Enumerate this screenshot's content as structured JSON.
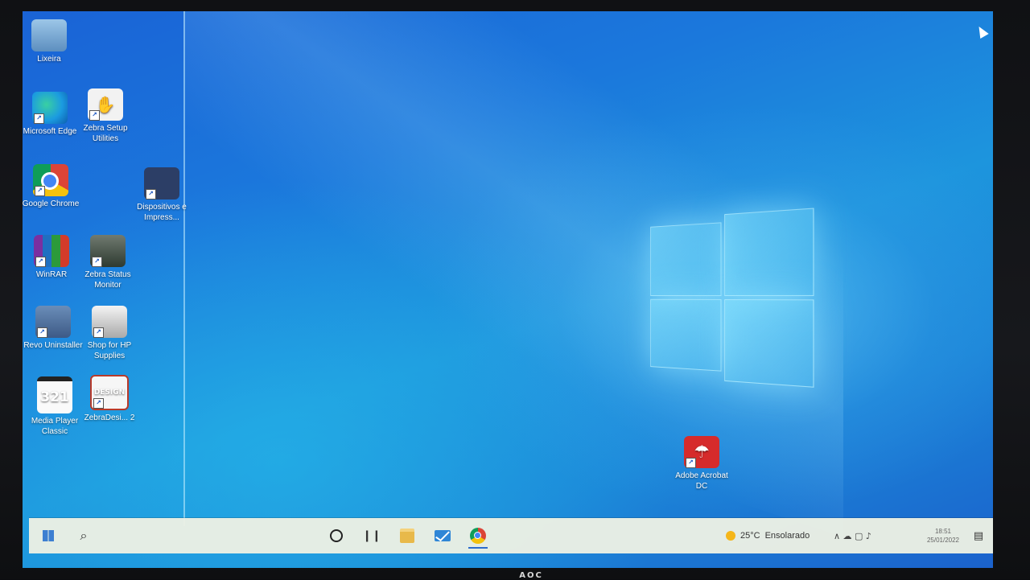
{
  "desktop": {
    "icons": [
      {
        "id": "recycle-bin",
        "label": "Lixeira",
        "icon": "recycle-bin-icon",
        "shortcut": false
      },
      {
        "id": "microsoft-edge",
        "label": "Microsoft Edge",
        "icon": "edge-icon",
        "shortcut": true
      },
      {
        "id": "zebra-setup",
        "label": "Zebra Setup Utilities",
        "icon": "zebra-setup-icon",
        "shortcut": true
      },
      {
        "id": "google-chrome",
        "label": "Google Chrome",
        "icon": "chrome-icon",
        "shortcut": true
      },
      {
        "id": "dispositivos",
        "label": "Dispositivos e Impress...",
        "icon": "printer-icon",
        "shortcut": true
      },
      {
        "id": "winrar",
        "label": "WinRAR",
        "icon": "winrar-icon",
        "shortcut": true
      },
      {
        "id": "zebra-status",
        "label": "Zebra Status Monitor",
        "icon": "zebra-status-icon",
        "shortcut": true
      },
      {
        "id": "revo",
        "label": "Revo Uninstaller",
        "icon": "revo-icon",
        "shortcut": true
      },
      {
        "id": "hp-supplies",
        "label": "Shop for HP Supplies",
        "icon": "hp-printer-icon",
        "shortcut": true
      },
      {
        "id": "mpc",
        "label": "Media Player Classic",
        "icon": "media-player-icon",
        "shortcut": false
      },
      {
        "id": "zebradesigner",
        "label": "ZebraDesi... 2",
        "icon": "zebradesigner-icon",
        "shortcut": true
      },
      {
        "id": "acrobat",
        "label": "Adobe Acrobat DC",
        "icon": "acrobat-icon",
        "shortcut": true
      }
    ],
    "glyphs": {
      "zebra_setup": "✋",
      "mpc": "321",
      "zebradesigner": "DESIGN",
      "acrobat": "☂"
    }
  },
  "taskbar": {
    "search_glyph": "⌕",
    "taskview_glyph": "❙❙",
    "weather_temp": "25°C",
    "weather_text": "Ensolarado",
    "tray_glyphs": "∧  ☁  ▢  ♪",
    "time": "18:51",
    "date": "25/01/2022",
    "notification_glyph": "▤"
  },
  "monitor": {
    "brand": "AOC"
  },
  "colors": {
    "accent": "#2c6ccc",
    "wallpaper": "#1b78dc"
  }
}
